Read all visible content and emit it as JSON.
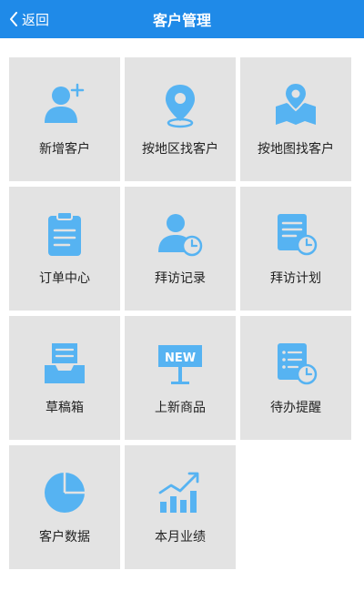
{
  "header": {
    "back_label": "返回",
    "title": "客户管理",
    "bar_color": "#1f8ae8"
  },
  "accent_color": "#56b3f2",
  "tiles": [
    {
      "label": "新增客户",
      "icon": "add-user-icon"
    },
    {
      "label": "按地区找客户",
      "icon": "location-pin-icon"
    },
    {
      "label": "按地图找客户",
      "icon": "map-pin-icon"
    },
    {
      "label": "订单中心",
      "icon": "clipboard-icon"
    },
    {
      "label": "拜访记录",
      "icon": "user-clock-icon"
    },
    {
      "label": "拜访计划",
      "icon": "document-clock-icon"
    },
    {
      "label": "草稿箱",
      "icon": "tray-icon"
    },
    {
      "label": "上新商品",
      "icon": "new-sign-icon"
    },
    {
      "label": "待办提醒",
      "icon": "list-clock-icon"
    },
    {
      "label": "客户数据",
      "icon": "pie-chart-icon"
    },
    {
      "label": "本月业绩",
      "icon": "bar-chart-trend-icon"
    }
  ]
}
